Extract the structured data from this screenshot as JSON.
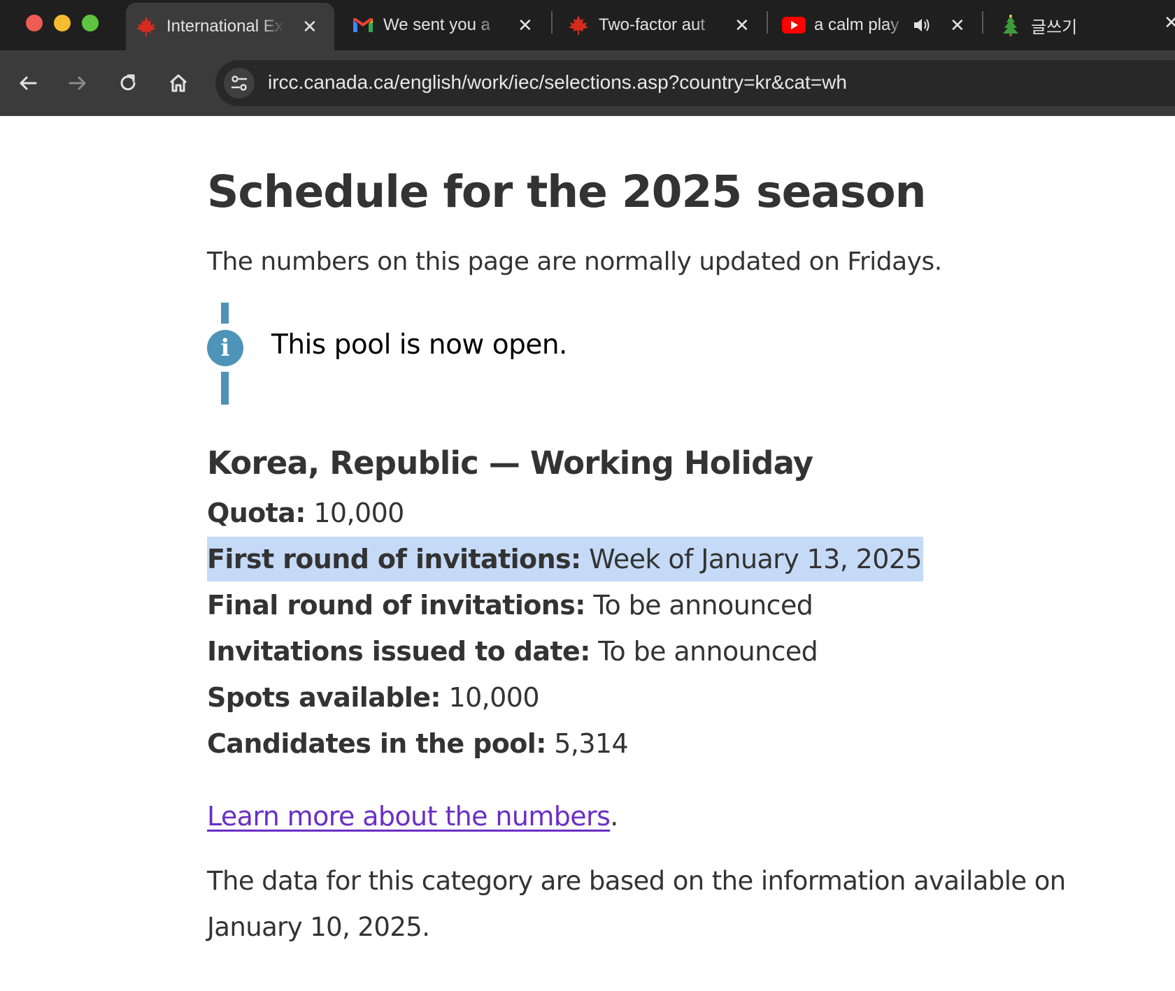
{
  "browser": {
    "tabs": [
      {
        "title": "International Ex",
        "favicon": "maple-leaf-icon",
        "active": true
      },
      {
        "title": "We sent you a",
        "favicon": "gmail-icon",
        "active": false
      },
      {
        "title": "Two-factor aut",
        "favicon": "maple-leaf-icon",
        "active": false
      },
      {
        "title": "a calm play",
        "favicon": "youtube-icon",
        "active": false,
        "audio": true
      },
      {
        "title": "글쓰기",
        "favicon": "tree-icon",
        "active": false
      }
    ],
    "url": "ircc.canada.ca/english/work/iec/selections.asp?country=kr&cat=wh"
  },
  "page": {
    "title": "Schedule for the 2025 season",
    "intro": "The numbers on this page are normally updated on Fridays.",
    "alert": "This pool is now open.",
    "section_title": "Korea, Republic — Working Holiday",
    "stats": [
      {
        "label": "Quota:",
        "value": "10,000"
      },
      {
        "label": "First round of invitations:",
        "value": "Week of January 13, 2025"
      },
      {
        "label": "Final round of invitations:",
        "value": "To be announced"
      },
      {
        "label": "Invitations issued to date:",
        "value": "To be announced"
      },
      {
        "label": "Spots available:",
        "value": "10,000"
      },
      {
        "label": "Candidates in the pool:",
        "value": "5,314"
      }
    ],
    "learn_more": {
      "link_text": "Learn more about the numbers",
      "suffix": "."
    },
    "footnote": "The data for this category are based on the information available on January 10, 2025."
  },
  "colors": {
    "tabstrip": "#1f1f1f",
    "toolbar": "#3b3b3b",
    "alert_accent": "#4e94b8",
    "selection_highlight": "#c5daf7",
    "link": "#6a2fc4",
    "text": "#333333"
  }
}
